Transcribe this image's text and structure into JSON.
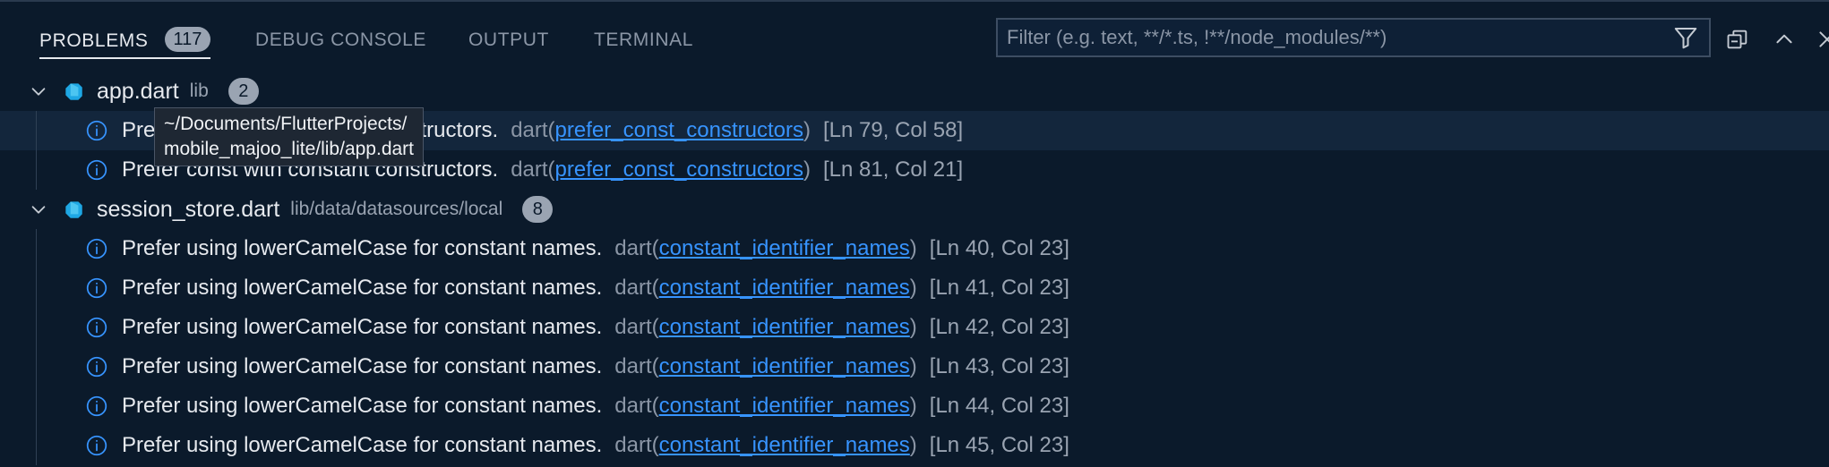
{
  "tabs": [
    {
      "label": "PROBLEMS",
      "badge": "117",
      "active": true
    },
    {
      "label": "DEBUG CONSOLE"
    },
    {
      "label": "OUTPUT"
    },
    {
      "label": "TERMINAL"
    }
  ],
  "filter": {
    "placeholder": "Filter (e.g. text, **/*.ts, !**/node_modules/**)",
    "value": ""
  },
  "icons": {
    "filter": "funnel-icon",
    "collapse_all": "collapse-all-icon",
    "maximize": "chevron-up-icon",
    "close": "close-icon",
    "file": "dart-file-icon",
    "issue": "info-icon",
    "expand": "chevron-down-icon"
  },
  "colors": {
    "background": "#0b1a2b",
    "link": "#3794ff",
    "info": "#3794ff",
    "dart": "#1ea7e4"
  },
  "files": [
    {
      "name": "app.dart",
      "path": "lib",
      "count": "2",
      "issues": [
        {
          "message": "Prefer const with constant constructors.",
          "source": "dart",
          "code": "prefer_const_constructors",
          "location": "[Ln 79, Col 58]"
        },
        {
          "message": "Prefer const with constant constructors.",
          "source": "dart",
          "code": "prefer_const_constructors",
          "location": "[Ln 81, Col 21]"
        }
      ]
    },
    {
      "name": "session_store.dart",
      "path": "lib/data/datasources/local",
      "count": "8",
      "issues": [
        {
          "message": "Prefer using lowerCamelCase for constant names.",
          "source": "dart",
          "code": "constant_identifier_names",
          "location": "[Ln 40, Col 23]"
        },
        {
          "message": "Prefer using lowerCamelCase for constant names.",
          "source": "dart",
          "code": "constant_identifier_names",
          "location": "[Ln 41, Col 23]"
        },
        {
          "message": "Prefer using lowerCamelCase for constant names.",
          "source": "dart",
          "code": "constant_identifier_names",
          "location": "[Ln 42, Col 23]"
        },
        {
          "message": "Prefer using lowerCamelCase for constant names.",
          "source": "dart",
          "code": "constant_identifier_names",
          "location": "[Ln 43, Col 23]"
        },
        {
          "message": "Prefer using lowerCamelCase for constant names.",
          "source": "dart",
          "code": "constant_identifier_names",
          "location": "[Ln 44, Col 23]"
        },
        {
          "message": "Prefer using lowerCamelCase for constant names.",
          "source": "dart",
          "code": "constant_identifier_names",
          "location": "[Ln 45, Col 23]"
        }
      ]
    }
  ],
  "tooltip": {
    "line1": "~/Documents/FlutterProjects/",
    "line2": "mobile_majoo_lite/lib/app.dart"
  }
}
